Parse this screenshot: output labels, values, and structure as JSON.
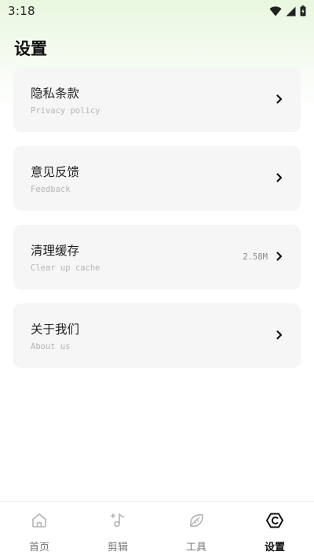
{
  "status_bar": {
    "time": "3:18"
  },
  "page": {
    "title": "设置"
  },
  "settings": {
    "items": [
      {
        "title": "隐私条款",
        "subtitle": "Privacy policy",
        "value": ""
      },
      {
        "title": "意见反馈",
        "subtitle": "Feedback",
        "value": ""
      },
      {
        "title": "清理缓存",
        "subtitle": "Clear up cache",
        "value": "2.58M"
      },
      {
        "title": "关于我们",
        "subtitle": "About us",
        "value": ""
      }
    ]
  },
  "tabbar": {
    "tabs": [
      {
        "label": "首页",
        "icon": "home-icon",
        "active": false
      },
      {
        "label": "剪辑",
        "icon": "music-note-sparkle-icon",
        "active": false
      },
      {
        "label": "工具",
        "icon": "leaf-icon",
        "active": false
      },
      {
        "label": "设置",
        "icon": "hexagon-settings-icon",
        "active": true
      }
    ]
  },
  "colors": {
    "header_tint": "#e8f7df",
    "card_background": "#f6f6f6",
    "active_tab": "#111111",
    "inactive_tab": "#777777"
  }
}
